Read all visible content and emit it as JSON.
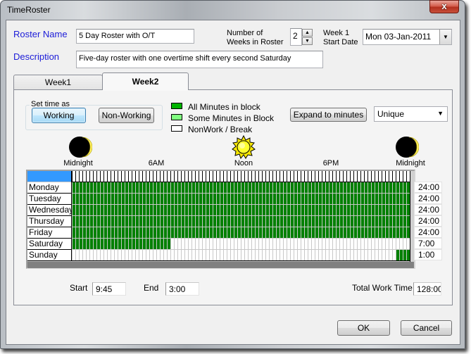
{
  "window": {
    "title": "TimeRoster",
    "close_glyph": "x"
  },
  "header": {
    "roster_name_label": "Roster Name",
    "roster_name_value": "5 Day Roster with O/T",
    "description_label": "Description",
    "description_value": "Five-day roster with one overtime shift every second Saturday",
    "weeks_label_line1": "Number of",
    "weeks_label_line2": "Weeks in Roster",
    "weeks_value": "2",
    "start_label_line1": "Week 1",
    "start_label_line2": "Start Date",
    "start_date_value": "Mon 03-Jan-2011"
  },
  "tabs": [
    {
      "label": "Week1",
      "selected": false
    },
    {
      "label": "Week2",
      "selected": true
    }
  ],
  "set_time": {
    "group_label": "Set time as",
    "working_label": "Working",
    "non_working_label": "Non-Working",
    "active": "Working"
  },
  "legend": [
    {
      "label": "All Minutes in block",
      "color": "#00b400"
    },
    {
      "label": "Some Minutes in Block",
      "color": "#80ff80"
    },
    {
      "label": "NonWork / Break",
      "color": "#ffffff"
    }
  ],
  "expand_button_label": "Expand to minutes",
  "mode_select": {
    "value": "Unique"
  },
  "timeline": {
    "markers": [
      {
        "label": "Midnight",
        "icon": "moon-icon"
      },
      {
        "label": "6AM"
      },
      {
        "label": "Noon",
        "icon": "sun-icon"
      },
      {
        "label": "6PM"
      },
      {
        "label": "Midnight",
        "icon": "moon-icon"
      }
    ]
  },
  "grid": {
    "block_minutes": 15,
    "header_color": "#3399ff",
    "work_color": "#008000",
    "nonwork_color": "#ffffff",
    "days": [
      {
        "name": "Monday",
        "work_hours": [
          [
            0,
            24
          ]
        ],
        "total": "24:00"
      },
      {
        "name": "Tuesday",
        "work_hours": [
          [
            0,
            24
          ]
        ],
        "total": "24:00"
      },
      {
        "name": "Wednesday",
        "work_hours": [
          [
            0,
            24
          ]
        ],
        "total": "24:00"
      },
      {
        "name": "Thursday",
        "work_hours": [
          [
            0,
            24
          ]
        ],
        "total": "24:00"
      },
      {
        "name": "Friday",
        "work_hours": [
          [
            0,
            24
          ]
        ],
        "total": "24:00"
      },
      {
        "name": "Saturday",
        "work_hours": [
          [
            0,
            7
          ]
        ],
        "total": "7:00"
      },
      {
        "name": "Sunday",
        "work_hours": [
          [
            23,
            24
          ]
        ],
        "total": "1:00"
      }
    ]
  },
  "footer": {
    "start_label": "Start",
    "start_value": "9:45",
    "end_label": "End",
    "end_value": "3:00",
    "total_label": "Total Work Time",
    "total_value": "128:00"
  },
  "buttons": {
    "ok": "OK",
    "cancel": "Cancel"
  }
}
